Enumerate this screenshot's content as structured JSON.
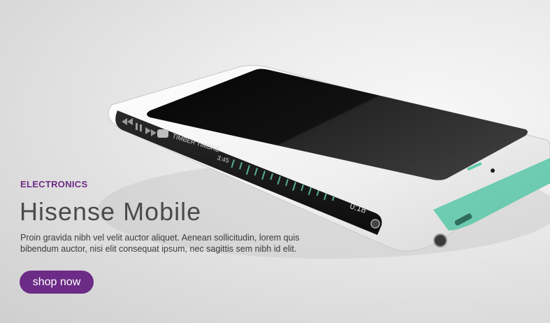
{
  "banner": {
    "category": "ELECTRONICS",
    "title": "Hisense Mobile",
    "description": "Proin gravida nibh vel velit auctor aliquet. Aenean sollicitudin, lorem quis bibendum auctor, nisi elit consequat ipsum, nec sagittis sem nibh id elit.",
    "cta_label": "shop now",
    "accent_color": "#6c2b86"
  },
  "phone": {
    "track_title": "TIMBER TIMBRE",
    "elapsed_time": "3:45",
    "remaining_time": "0:18",
    "body_color": "#f4f4f4",
    "accent_color": "#5fc9ab",
    "icons": [
      "rewind-icon",
      "pause-icon",
      "fast-forward-icon",
      "message-icon"
    ]
  }
}
